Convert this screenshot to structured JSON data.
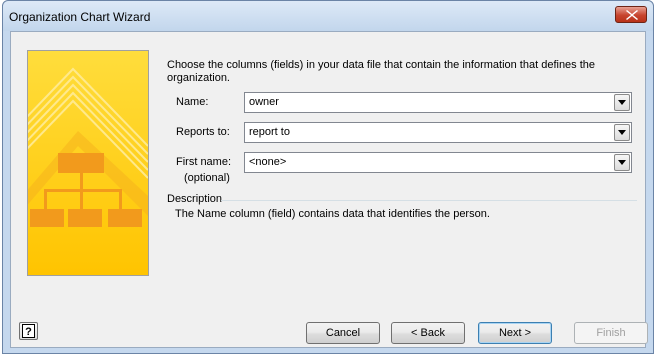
{
  "window": {
    "title": "Organization Chart Wizard"
  },
  "prompt": "Choose the columns (fields) in your data file that contain the information that defines the organization.",
  "fields": [
    {
      "label": "Name:",
      "optional": "",
      "value": "owner"
    },
    {
      "label": "Reports to:",
      "optional": "",
      "value": "report to"
    },
    {
      "label": "First name:",
      "optional": "(optional)",
      "value": "<none>"
    }
  ],
  "description": {
    "heading": "Description",
    "text": "The Name column (field) contains data that identifies the person."
  },
  "buttons": {
    "cancel": "Cancel",
    "back": "< Back",
    "next": "Next >",
    "finish": "Finish"
  },
  "icons": {
    "close": "close-icon",
    "help": "help-icon",
    "dropdown": "chevron-down-icon"
  },
  "colors": {
    "banner_yellow": "#ffd21a",
    "banner_orange": "#f29a1c",
    "close_red": "#c7442e"
  }
}
